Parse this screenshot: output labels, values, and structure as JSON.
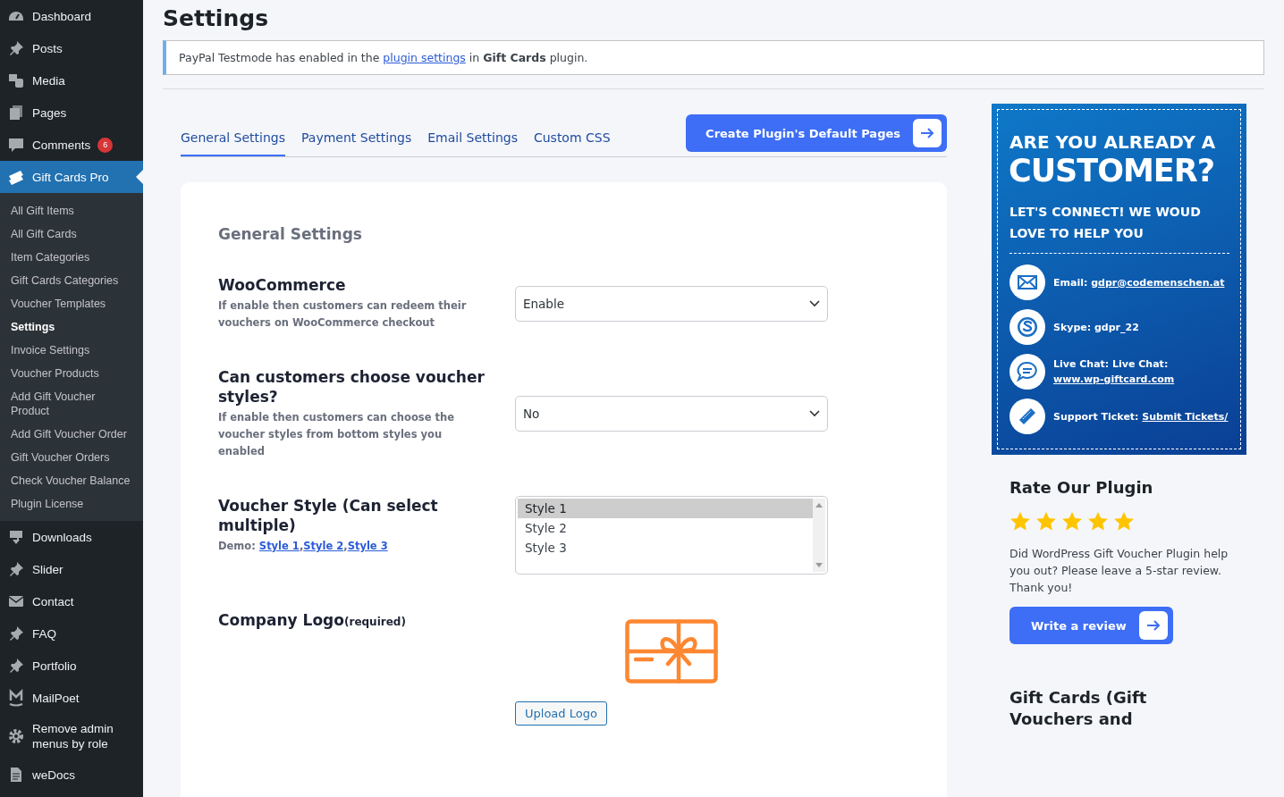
{
  "sidebar": {
    "items": [
      {
        "label": "Dashboard",
        "selected": false
      },
      {
        "label": "Posts",
        "selected": false
      },
      {
        "label": "Media",
        "selected": false
      },
      {
        "label": "Pages",
        "selected": false
      },
      {
        "label": "Comments",
        "badge": "6",
        "selected": false
      },
      {
        "label": "Gift Cards Pro",
        "selected": true,
        "children": [
          {
            "label": "All Gift Items",
            "selected": false
          },
          {
            "label": "All Gift Cards",
            "selected": false
          },
          {
            "label": "Item Categories",
            "selected": false
          },
          {
            "label": "Gift Cards Categories",
            "selected": false
          },
          {
            "label": "Voucher Templates",
            "selected": false
          },
          {
            "label": "Settings",
            "selected": true
          },
          {
            "label": "Invoice Settings",
            "selected": false
          },
          {
            "label": "Voucher Products",
            "selected": false
          },
          {
            "label": "Add Gift Voucher Product",
            "selected": false
          },
          {
            "label": "Add Gift Voucher Order",
            "selected": false
          },
          {
            "label": "Gift Voucher Orders",
            "selected": false
          },
          {
            "label": "Check Voucher Balance",
            "selected": false
          },
          {
            "label": "Plugin License",
            "selected": false
          }
        ]
      },
      {
        "label": "Downloads",
        "selected": false
      },
      {
        "label": "Slider",
        "selected": false
      },
      {
        "label": "Contact",
        "selected": false
      },
      {
        "label": "FAQ",
        "selected": false
      },
      {
        "label": "Portfolio",
        "selected": false
      },
      {
        "label": "MailPoet",
        "selected": false
      },
      {
        "label": "Remove admin menus by role",
        "selected": false
      },
      {
        "label": "weDocs",
        "selected": false
      }
    ]
  },
  "page": {
    "title": "Settings"
  },
  "notice": {
    "before": "PayPal Testmode has enabled in the",
    "link": "plugin settings",
    "after": "in **Gift Cards** plugin."
  },
  "tabs": [
    {
      "label": "General Settings",
      "selected": true
    },
    {
      "label": "Payment Settings",
      "selected": false
    },
    {
      "label": "Email Settings",
      "selected": false
    },
    {
      "label": "Custom CSS",
      "selected": false
    }
  ],
  "create_button": {
    "label": "Create Plugin's Default Pages"
  },
  "settings_panel": {
    "title": "General Settings",
    "fields": [
      {
        "kind": "select",
        "label": "WooCommerce",
        "description": "If enable then customers can redeem their vouchers on WooCommerce checkout",
        "value": "Enable"
      },
      {
        "kind": "select",
        "label": "Can customers choose voucher styles?",
        "description": "If enable then customers can choose the voucher styles from bottom styles you enabled",
        "value": "No"
      },
      {
        "kind": "listbox",
        "label": "Voucher Style (Can select multiple)",
        "demo_label": "Demo:",
        "demo_separator": ",",
        "demo_links": [
          "Style 1",
          "Style 2",
          "Style 3"
        ],
        "options": [
          {
            "label": "Style 1",
            "selected": true
          },
          {
            "label": "Style 2",
            "selected": false
          },
          {
            "label": "Style 3",
            "selected": false
          }
        ]
      },
      {
        "kind": "logo",
        "label": "Company Logo",
        "note": "(required)",
        "button": "Upload Logo"
      }
    ]
  },
  "contact_box": {
    "heading_small": "ARE YOU ALREADY A",
    "heading_large": "CUSTOMER?",
    "subheading": "LET'S CONNECT! WE WOUD LOVE TO HELP YOU",
    "contacts": [
      {
        "kind": "email",
        "label": "Email:",
        "link": "gdpr@codemenschen.at"
      },
      {
        "kind": "skype",
        "label": "Skype: gdpr_22"
      },
      {
        "kind": "chat",
        "label": "Live Chat: Live Chat:",
        "link": "www.wp-giftcard.com"
      },
      {
        "kind": "ticket",
        "label": "Support Ticket:",
        "link": "Submit Tickets/"
      }
    ]
  },
  "rating": {
    "title": "Rate Our Plugin",
    "stars": 5,
    "text": "Did WordPress Gift Voucher Plugin help you out? Please leave a 5-star review. Thank you!",
    "button": "Write a review"
  },
  "promo": {
    "title": "Gift Cards (Gift Vouchers and"
  }
}
